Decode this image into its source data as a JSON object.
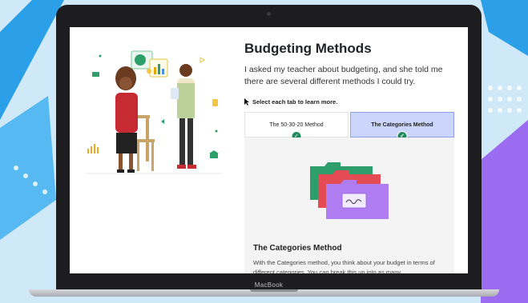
{
  "device": {
    "brand_label": "MacBook"
  },
  "page": {
    "title": "Budgeting Methods",
    "intro": "I asked my teacher about budgeting, and she told me there are several different methods I could try.",
    "instruction": "Select each tab to learn more."
  },
  "tabs": [
    {
      "label": "The 50-30-20 Method",
      "active": false,
      "completed": true
    },
    {
      "label": "The Categories Method",
      "active": true,
      "completed": true
    }
  ],
  "panel": {
    "heading": "The Categories Method",
    "text": "With the Categories method, you think about your budget in terms of different categories. You can break this up into as many"
  },
  "colors": {
    "accent_tab": "#ccd5fb",
    "check": "#1f8a5c",
    "folder_green": "#2e9e6b",
    "folder_red": "#e44b55",
    "folder_purple": "#b07cf2"
  }
}
